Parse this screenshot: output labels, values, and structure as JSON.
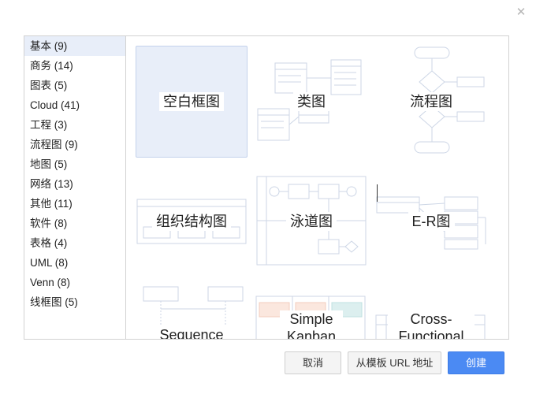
{
  "dialog": {
    "close_icon": "close-icon"
  },
  "sidebar": {
    "items": [
      {
        "label": "基本 (9)"
      },
      {
        "label": "商务 (14)"
      },
      {
        "label": "图表 (5)"
      },
      {
        "label": "Cloud (41)"
      },
      {
        "label": "工程 (3)"
      },
      {
        "label": "流程图 (9)"
      },
      {
        "label": "地图 (5)"
      },
      {
        "label": "网络 (13)"
      },
      {
        "label": "其他 (11)"
      },
      {
        "label": "软件 (8)"
      },
      {
        "label": "表格 (4)"
      },
      {
        "label": "UML (8)"
      },
      {
        "label": "Venn (8)"
      },
      {
        "label": "线框图 (5)"
      }
    ],
    "active_index": 0
  },
  "templates": [
    {
      "label": "空白框图"
    },
    {
      "label": "类图"
    },
    {
      "label": "流程图"
    },
    {
      "label": "组织结构图"
    },
    {
      "label": "泳道图"
    },
    {
      "label": "E-R图"
    },
    {
      "label": "Sequence"
    },
    {
      "label": "Simple Kanban"
    },
    {
      "label": "Cross-Functional"
    }
  ],
  "buttons": {
    "cancel": "取消",
    "from_url": "从模板 URL 地址",
    "create": "创建"
  },
  "colors": {
    "accent": "#4b8af3",
    "selected_bg": "#e8eef9",
    "thumbnail_stroke": "#cdd6e6"
  }
}
